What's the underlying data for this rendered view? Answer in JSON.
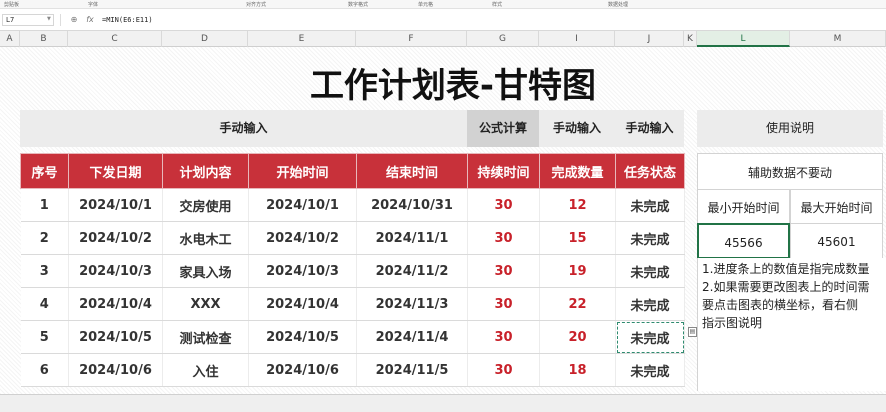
{
  "ribbon": {
    "groups": [
      "剪贴板",
      "字体",
      "对齐方式",
      "数字格式",
      "单元格",
      "样式",
      "数据处理"
    ]
  },
  "formula_bar": {
    "cell_ref": "L7",
    "fx_label": "fx",
    "formula": "=MIN(E6:E11)"
  },
  "columns": [
    "A",
    "B",
    "C",
    "D",
    "E",
    "F",
    "G",
    "I",
    "J",
    "K",
    "L",
    "M"
  ],
  "selected_column": "L",
  "sheet": {
    "title": "工作计划表-甘特图",
    "bands": {
      "manual_1": "手动输入",
      "formula": "公式计算",
      "manual_2": "手动输入",
      "manual_3": "手动输入",
      "help": "使用说明"
    },
    "table": {
      "headers": [
        "序号",
        "下发日期",
        "计划内容",
        "开始时间",
        "结束时间",
        "持续时间",
        "完成数量",
        "任务状态"
      ],
      "rows": [
        [
          "1",
          "2024/10/1",
          "交房使用",
          "2024/10/1",
          "2024/10/31",
          "30",
          "12",
          "未完成"
        ],
        [
          "2",
          "2024/10/2",
          "水电木工",
          "2024/10/2",
          "2024/11/1",
          "30",
          "15",
          "未完成"
        ],
        [
          "3",
          "2024/10/3",
          "家具入场",
          "2024/10/3",
          "2024/11/2",
          "30",
          "19",
          "未完成"
        ],
        [
          "4",
          "2024/10/4",
          "XXX",
          "2024/10/4",
          "2024/11/3",
          "30",
          "22",
          "未完成"
        ],
        [
          "5",
          "2024/10/5",
          "测试检查",
          "2024/10/5",
          "2024/11/4",
          "30",
          "20",
          "未完成"
        ],
        [
          "6",
          "2024/10/6",
          "入住",
          "2024/10/6",
          "2024/11/5",
          "30",
          "18",
          "未完成"
        ]
      ]
    },
    "aux": {
      "heading": "辅助数据不要动",
      "min_label": "最小开始时间",
      "max_label": "最大开始时间",
      "min_value": "45566",
      "max_value": "45601"
    },
    "notes": [
      "1.进度条上的数值是指完成数量",
      "2.如果需要更改图表上的时间需",
      "要点击图表的横坐标，看右侧",
      "指示图说明"
    ]
  },
  "colors": {
    "header_red": "#c8313a",
    "value_red": "#c8212a",
    "selection_green": "#217346"
  }
}
